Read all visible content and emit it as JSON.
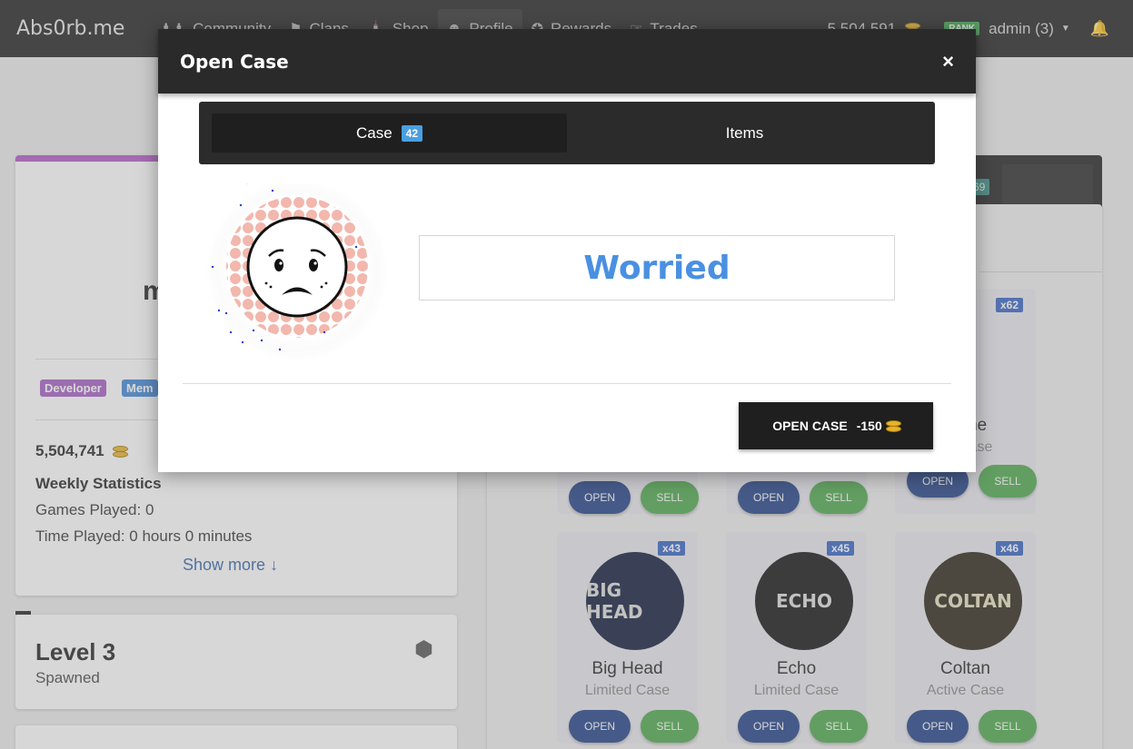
{
  "navbar": {
    "brand": "Abs0rb.me",
    "items": [
      {
        "label": "Community",
        "icon": "users-icon"
      },
      {
        "label": "Clans",
        "icon": "flag-icon"
      },
      {
        "label": "Shop",
        "icon": "store-icon"
      },
      {
        "label": "Profile",
        "icon": "user-icon"
      },
      {
        "label": "Rewards",
        "icon": "award-icon"
      },
      {
        "label": "Trades",
        "icon": "handshake-icon"
      }
    ],
    "balance": "5,504,591",
    "rank_badge": "RANK",
    "user": "admin (3)"
  },
  "profile": {
    "name_fragment": "m",
    "tags": [
      "Developer",
      "Mem"
    ],
    "balance": "5,504,741",
    "weekly_title": "Weekly Statistics",
    "games_played": "Games Played: 0",
    "time_played": "Time Played: 0 hours 0 minutes",
    "show_more": "Show more"
  },
  "level": {
    "title": "Level 3",
    "subtitle": "Spawned"
  },
  "inventory": {
    "top_badge": "69",
    "row1": {
      "partial_name": "ntine",
      "partial_type": "Case"
    },
    "cards": [
      {
        "name": "Big Head",
        "type": "Limited Case",
        "count": "x43",
        "art_text": "BIG HEAD",
        "art_bg": "#0f1a3a"
      },
      {
        "name": "Echo",
        "type": "Limited Case",
        "count": "x45",
        "art_text": "ECHO",
        "art_bg": "#111111"
      },
      {
        "name": "Coltan",
        "type": "Active Case",
        "count": "x46",
        "art_text": "COLTAN",
        "art_bg": "#2a2416"
      }
    ],
    "row1_count": "x62",
    "open_label": "OPEN",
    "sell_label": "SELL"
  },
  "modal": {
    "title": "Open Case",
    "close": "×",
    "tabs": [
      {
        "label": "Case",
        "badge": "42"
      },
      {
        "label": "Items"
      }
    ],
    "result": "Worried",
    "open_button": "OPEN CASE",
    "open_cost": "-150"
  },
  "colors": {
    "accent_blue": "#4a90e2",
    "navbar_bg": "#212121",
    "open_btn": "#1f3f86",
    "sell_btn": "#4ca84a"
  }
}
